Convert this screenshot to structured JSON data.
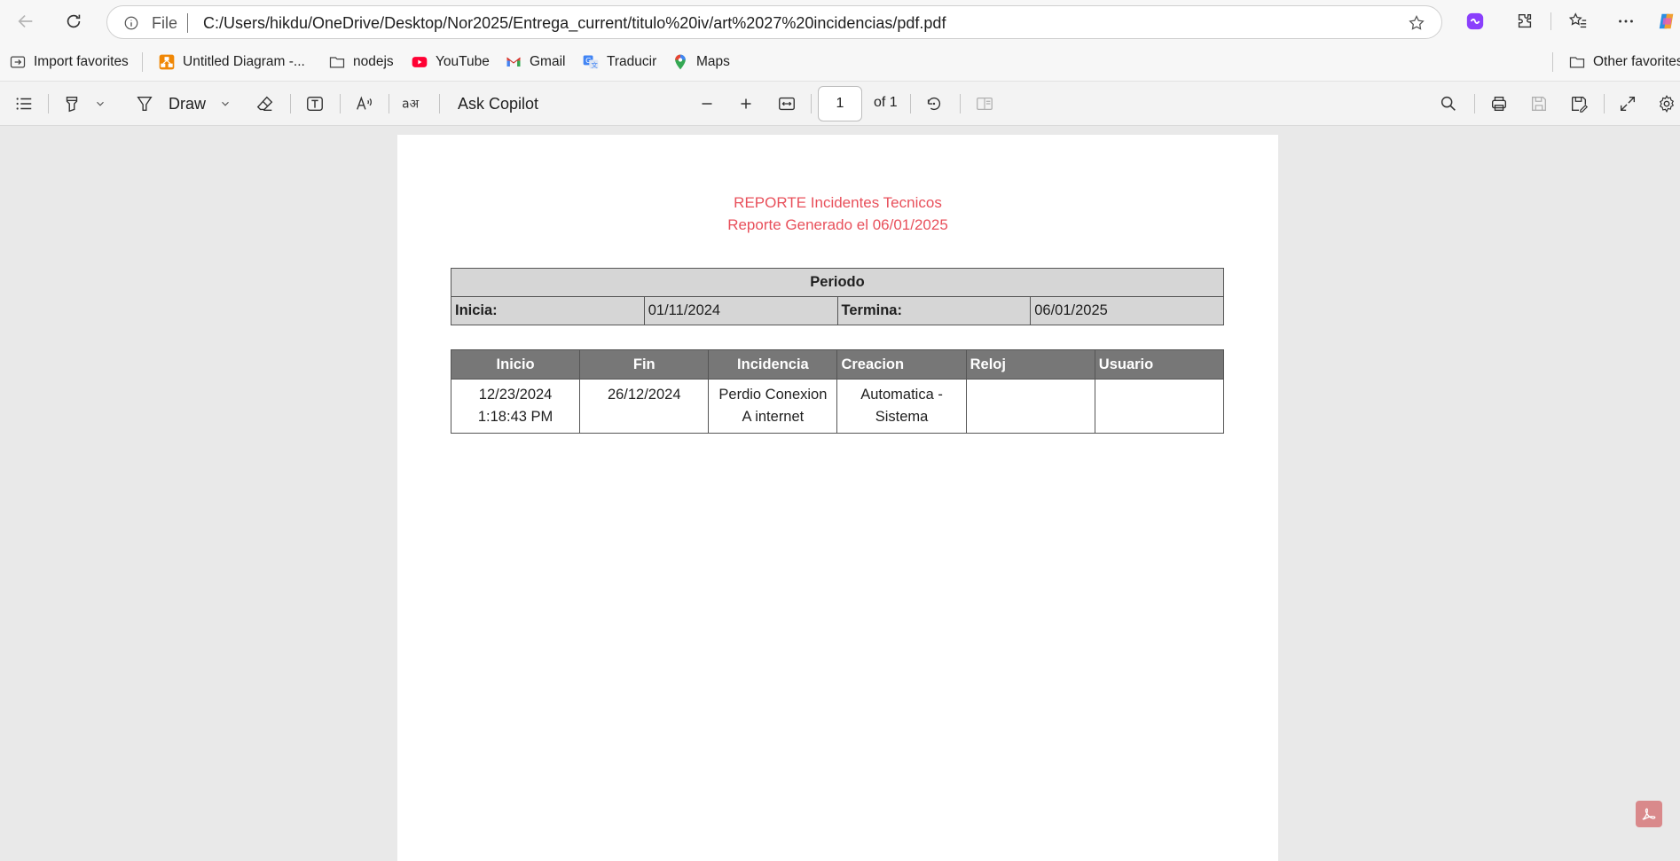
{
  "browser": {
    "omnibox": {
      "scheme": "File",
      "url": "C:/Users/hikdu/OneDrive/Desktop/Nor2025/Entrega_current/titulo%20iv/art%2027%20incidencias/pdf.pdf"
    },
    "favorites": [
      {
        "label": "Import favorites",
        "icon": "import-icon"
      },
      {
        "label": "Untitled Diagram -...",
        "icon": "drawio-icon"
      },
      {
        "label": "nodejs",
        "icon": "folder-icon"
      },
      {
        "label": "YouTube",
        "icon": "youtube-icon"
      },
      {
        "label": "Gmail",
        "icon": "gmail-icon"
      },
      {
        "label": "Traducir",
        "icon": "translate-icon"
      },
      {
        "label": "Maps",
        "icon": "maps-icon"
      }
    ],
    "other_favorites": "Other favorites"
  },
  "pdf_toolbar": {
    "draw_label": "Draw",
    "ask_copilot": "Ask Copilot",
    "page_current": "1",
    "page_of": "of 1"
  },
  "document": {
    "title": "REPORTE Incidentes Tecnicos",
    "subtitle": "Reporte Generado el 06/01/2025",
    "title_color": "#e8505b",
    "period": {
      "heading": "Periodo",
      "start_label": "Inicia:",
      "start_value": "01/11/2024",
      "end_label": "Termina:",
      "end_value": "06/01/2025"
    },
    "incidents": {
      "headers": [
        "Inicio",
        "Fin",
        "Incidencia",
        "Creacion",
        "Reloj",
        "Usuario"
      ],
      "rows": [
        {
          "inicio": [
            "12/23/2024",
            "1:18:43 PM"
          ],
          "fin": "26/12/2024",
          "incidencia": [
            "Perdio Conexion",
            "A internet"
          ],
          "creacion": [
            "Automatica -",
            "Sistema"
          ],
          "reloj": "",
          "usuario": ""
        }
      ]
    }
  }
}
